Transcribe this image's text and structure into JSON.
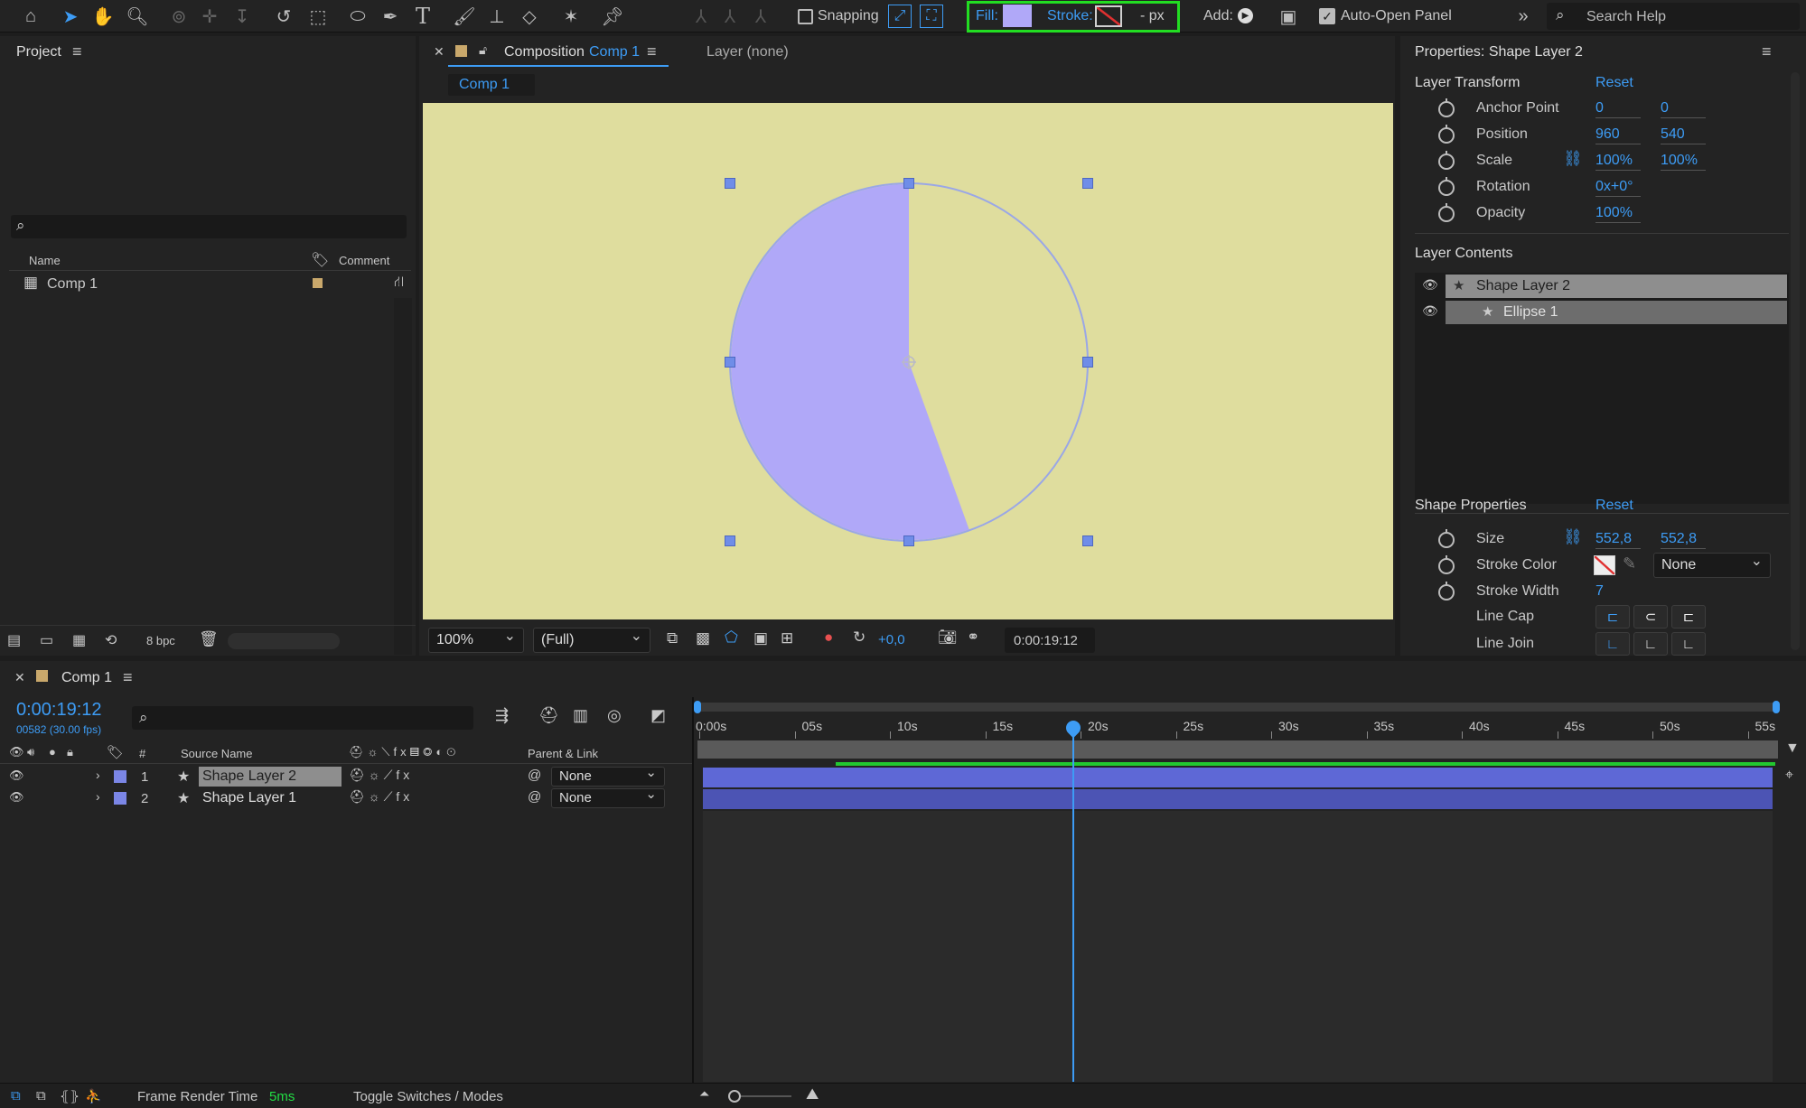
{
  "toolbar": {
    "snapping_label": "Snapping",
    "fill_label": "Fill:",
    "stroke_label": "Stroke:",
    "stroke_width": "- px",
    "add_label": "Add:",
    "auto_open_label": "Auto-Open Panel",
    "search_placeholder": "Search Help",
    "fill_color": "#b0a8f8",
    "highlight_color": "#22dd22"
  },
  "project": {
    "title": "Project",
    "col_name": "Name",
    "col_comment": "Comment",
    "item_name": "Comp 1",
    "bpc": "8 bpc"
  },
  "comp_viewer": {
    "tab_label": "Composition",
    "tab_comp": "Comp 1",
    "layer_tab": "Layer (none)",
    "sub_tab": "Comp 1",
    "zoom": "100%",
    "resolution": "(Full)",
    "exposure": "+0,0",
    "timecode": "0:00:19:12",
    "bg_color": "#dfdd9e",
    "pie_fraction_filled": 0.555
  },
  "properties": {
    "title": "Properties: Shape Layer 2",
    "layer_transform": "Layer Transform",
    "reset": "Reset",
    "anchor_label": "Anchor Point",
    "anchor_x": "0",
    "anchor_y": "0",
    "position_label": "Position",
    "position_x": "960",
    "position_y": "540",
    "scale_label": "Scale",
    "scale_x": "100%",
    "scale_y": "100%",
    "rotation_label": "Rotation",
    "rotation": "0x+0°",
    "opacity_label": "Opacity",
    "opacity": "100%",
    "layer_contents": "Layer Contents",
    "content_1": "Shape Layer 2",
    "content_2": "Ellipse 1",
    "shape_properties": "Shape Properties",
    "size_label": "Size",
    "size_w": "552,8",
    "size_h": "552,8",
    "stroke_color_label": "Stroke Color",
    "stroke_color_value": "None",
    "stroke_width_label": "Stroke Width",
    "stroke_width": "7",
    "line_cap_label": "Line Cap",
    "line_join_label": "Line Join"
  },
  "timeline": {
    "comp_tab": "Comp 1",
    "timecode": "0:00:19:12",
    "frame_info": "00582 (30.00 fps)",
    "col_number": "#",
    "col_source": "Source Name",
    "col_parent": "Parent & Link",
    "layers": [
      {
        "num": "1",
        "name": "Shape Layer 2",
        "parent": "None"
      },
      {
        "num": "2",
        "name": "Shape Layer 1",
        "parent": "None"
      }
    ],
    "ruler": [
      "0:00s",
      "05s",
      "10s",
      "15s",
      "20s",
      "25s",
      "30s",
      "35s",
      "40s",
      "45s",
      "50s",
      "55s"
    ],
    "layer_color": "#7b86e6"
  },
  "status": {
    "frame_render_label": "Frame Render Time",
    "frame_render_value": "5ms",
    "toggle_label": "Toggle Switches / Modes"
  }
}
